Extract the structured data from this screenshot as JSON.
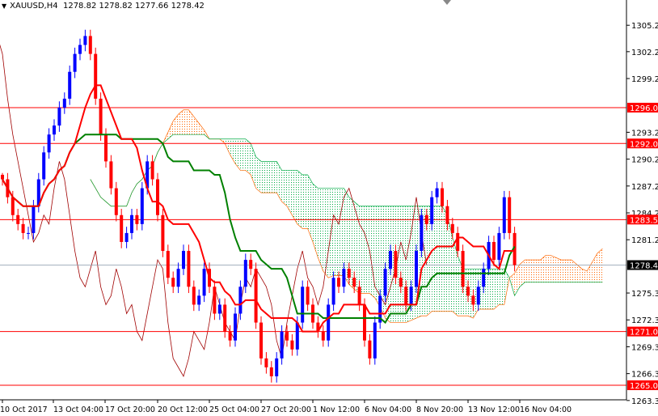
{
  "header": {
    "symbol": "XAUUSD,H4",
    "ohlc": "1278.82 1278.82 1277.66 1278.42"
  },
  "chart_data": {
    "type": "candlestick",
    "title": "XAUUSD,H4",
    "ylim": [
      1263.3,
      1306.5
    ],
    "y_ticks": [
      "1305.20",
      "1302.25",
      "1299.25",
      "1293.25",
      "1290.25",
      "1287.25",
      "1284.25",
      "1281.25",
      "1275.30",
      "1272.30",
      "1269.30",
      "1266.30",
      "1263.30"
    ],
    "x_ticks": [
      "10 Oct 2017",
      "13 Oct 04:00",
      "17 Oct 20:00",
      "20 Oct 12:00",
      "25 Oct 04:00",
      "27 Oct 20:00",
      "1 Nov 12:00",
      "6 Nov 04:00",
      "8 Nov 20:00",
      "13 Nov 12:00",
      "16 Nov 04:00"
    ],
    "levels": [
      {
        "value": 1296.0,
        "label": "1296.00"
      },
      {
        "value": 1292.0,
        "label": "1292.00"
      },
      {
        "value": 1283.5,
        "label": "1283.50"
      },
      {
        "value": 1271.0,
        "label": "1271.00"
      },
      {
        "value": 1265.0,
        "label": "1265.00"
      }
    ],
    "current_price": {
      "value": 1278.42,
      "label": "1278.42"
    },
    "closes": [
      1288,
      1286,
      1284,
      1283,
      1282,
      1282,
      1285,
      1288,
      1291,
      1293,
      1294,
      1296,
      1297,
      1300,
      1302,
      1303,
      1304,
      1302,
      1297,
      1293,
      1290,
      1287,
      1284,
      1281,
      1282,
      1284,
      1283,
      1287,
      1290,
      1288,
      1284,
      1280,
      1277,
      1276,
      1278,
      1280,
      1276,
      1274,
      1275,
      1278,
      1276,
      1273,
      1274,
      1271,
      1270,
      1273,
      1276,
      1279,
      1278,
      1272,
      1268,
      1267,
      1266,
      1268,
      1271,
      1270,
      1269,
      1272,
      1276,
      1274,
      1272,
      1271,
      1270,
      1274,
      1277,
      1276,
      1278,
      1277,
      1276,
      1274,
      1270,
      1268,
      1272,
      1275,
      1278,
      1280,
      1277,
      1276,
      1274,
      1276,
      1280,
      1284,
      1283,
      1286,
      1287,
      1285,
      1283,
      1282,
      1280,
      1276,
      1275,
      1274,
      1276,
      1278,
      1281,
      1279,
      1282,
      1286,
      1282,
      1278.42
    ],
    "indicators": [
      "tenkan-sen",
      "kijun-sen",
      "senkou span A",
      "senkou span B",
      "chikou span"
    ],
    "colors": {
      "tenkan": "#ff0000",
      "kijun": "#008000",
      "chikou": "#a00000",
      "bull": "#0000ff",
      "bear": "#ff0000",
      "cloud_up": "#ff6600",
      "cloud_down": "#00aa44",
      "level": "#ff0000"
    }
  }
}
